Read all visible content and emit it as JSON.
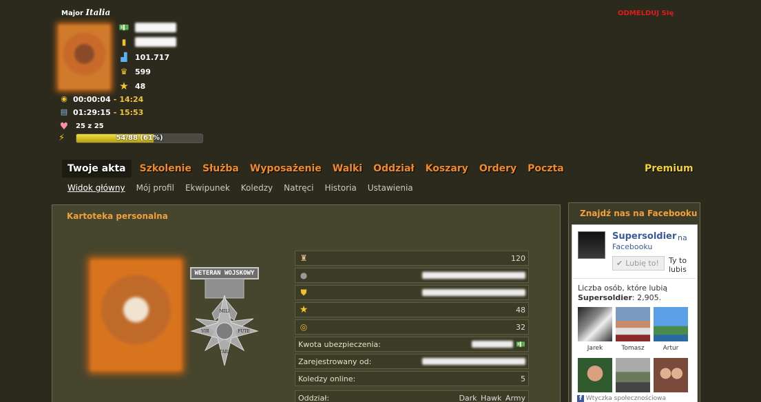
{
  "header": {
    "rank": "Major",
    "country": "Italia",
    "logout": "ODMELDUJ SIę"
  },
  "stats": {
    "points": "101.717",
    "crowns": "599",
    "stars": "48"
  },
  "timers": [
    {
      "elapsed": "00:00:04",
      "clock": "14:24"
    },
    {
      "elapsed": "01:29:15",
      "clock": "15:53"
    }
  ],
  "health": "25 z 25",
  "xp": {
    "label": "54/88 (61%)",
    "fraction": 0.61
  },
  "nav": {
    "items": [
      "Twoje akta",
      "Szkolenie",
      "Służba",
      "Wyposażenie",
      "Walki",
      "Oddział",
      "Koszary",
      "Ordery",
      "Poczta"
    ],
    "premium": "Premium"
  },
  "subnav": [
    "Widok główny",
    "Mój profil",
    "Ekwipunek",
    "Koledzy",
    "Natręci",
    "Historia",
    "Ustawienia"
  ],
  "panel": {
    "title": "Kartoteka personalna",
    "badge": "WETERAN WOJSKOWY",
    "medal_text": [
      "MILI",
      "VIR",
      "FUTE",
      "TARI"
    ],
    "rows": [
      {
        "icon": "soldier-icon",
        "value": "120"
      },
      {
        "icon": "bomb-icon",
        "value": ""
      },
      {
        "icon": "shield-icon",
        "value": ""
      },
      {
        "icon": "star-icon",
        "value": "48"
      },
      {
        "icon": "medal-icon",
        "value": "32"
      },
      {
        "label": "Kwota ubezpieczenia:",
        "value": ""
      },
      {
        "label": "Zarejestrowany od:",
        "value": ""
      },
      {
        "label": "Koledzy online:",
        "value": "5"
      },
      {
        "label": "Oddział:",
        "value": "Dark_Hawk_Army"
      }
    ]
  },
  "facebook": {
    "title": "Znajdź nas na Facebooku",
    "page_name": "Supersoldier",
    "on": "na",
    "fb": "Facebooku",
    "like_button": "Lubię to!",
    "you_like": "Ty to lubis",
    "count_text": "Liczba osób, które lubią",
    "count_name": "Supersoldier",
    "count_value": ": 2,905.",
    "friends": [
      "Jarek",
      "Tomasz",
      "Artur",
      "",
      "",
      ""
    ],
    "footer": "Wtyczka społecznościowa"
  },
  "colors": {
    "accent": "#f38a2a",
    "premium": "#f3d432",
    "logout": "#e01c1c",
    "background": "#2b2a1d"
  }
}
